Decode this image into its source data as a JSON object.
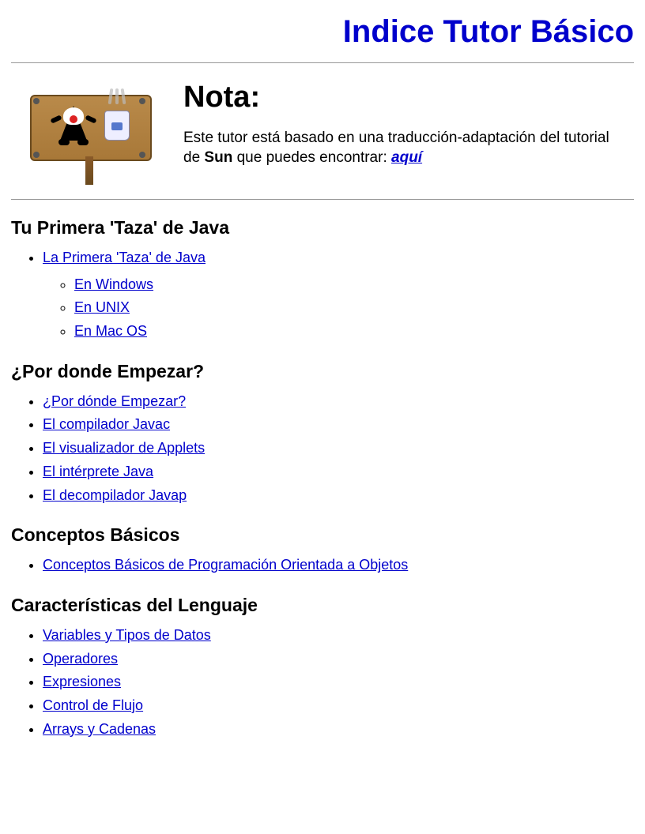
{
  "title": "Indice Tutor Básico",
  "note": {
    "heading": "Nota:",
    "text_before": "Este tutor está basado en una traducción-adaptación del tutorial de ",
    "bold_word": "Sun",
    "text_after": " que puedes encontrar: ",
    "link_text": "aquí"
  },
  "sections": [
    {
      "heading": "Tu Primera 'Taza' de Java",
      "items": [
        {
          "label": "La Primera 'Taza' de Java",
          "sub": [
            {
              "label": "En Windows"
            },
            {
              "label": "En UNIX"
            },
            {
              "label": "En Mac OS"
            }
          ]
        }
      ]
    },
    {
      "heading": "¿Por donde Empezar?",
      "items": [
        {
          "label": "¿Por dónde Empezar?"
        },
        {
          "label": "El compilador Javac"
        },
        {
          "label": "El visualizador de Applets"
        },
        {
          "label": "El intérprete Java"
        },
        {
          "label": "El decompilador Javap"
        }
      ]
    },
    {
      "heading": "Conceptos Básicos",
      "items": [
        {
          "label": "Conceptos Básicos de Programación Orientada a Objetos"
        }
      ]
    },
    {
      "heading": "Características del Lenguaje",
      "items": [
        {
          "label": "Variables y Tipos de Datos"
        },
        {
          "label": "Operadores"
        },
        {
          "label": "Expresiones"
        },
        {
          "label": "Control de Flujo"
        },
        {
          "label": "Arrays y Cadenas"
        }
      ]
    }
  ]
}
